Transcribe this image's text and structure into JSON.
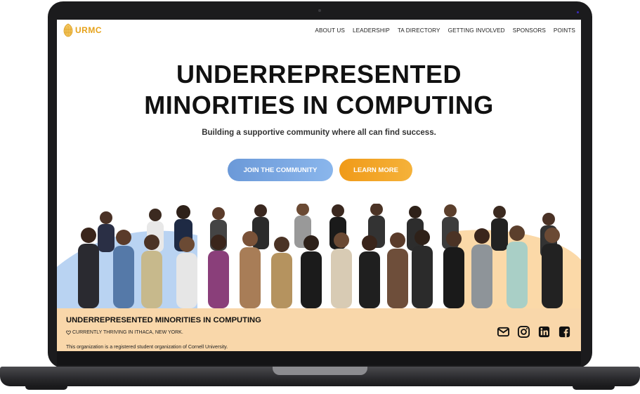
{
  "brand": {
    "logo_text": "URMC",
    "accent": "#e6a21a"
  },
  "nav": {
    "items": [
      {
        "label": "ABOUT US"
      },
      {
        "label": "LEADERSHIP"
      },
      {
        "label": "TA DIRECTORY"
      },
      {
        "label": "GETTING INVOLVED"
      },
      {
        "label": "SPONSORS"
      },
      {
        "label": "POINTS"
      }
    ]
  },
  "hero": {
    "title_line1": "UNDERREPRESENTED",
    "title_line2": "MINORITIES IN COMPUTING",
    "subtitle": "Building a supportive community where all can find success.",
    "join_button": "JOIN THE COMMUNITY",
    "learn_button": "LEARN MORE",
    "join_color": "#7aa8e2",
    "learn_color": "#f2a326"
  },
  "footer": {
    "title": "UNDERREPRESENTED MINORITIES IN COMPUTING",
    "location_icon": "heart-outline-icon",
    "location": "CURRENTLY THRIVING IN ITHACA, NEW YORK.",
    "note": "This organization is a registered student organization of Cornell University.",
    "background": "#f9d7aa",
    "socials": [
      "mail-icon",
      "instagram-icon",
      "linkedin-icon",
      "facebook-icon"
    ]
  }
}
